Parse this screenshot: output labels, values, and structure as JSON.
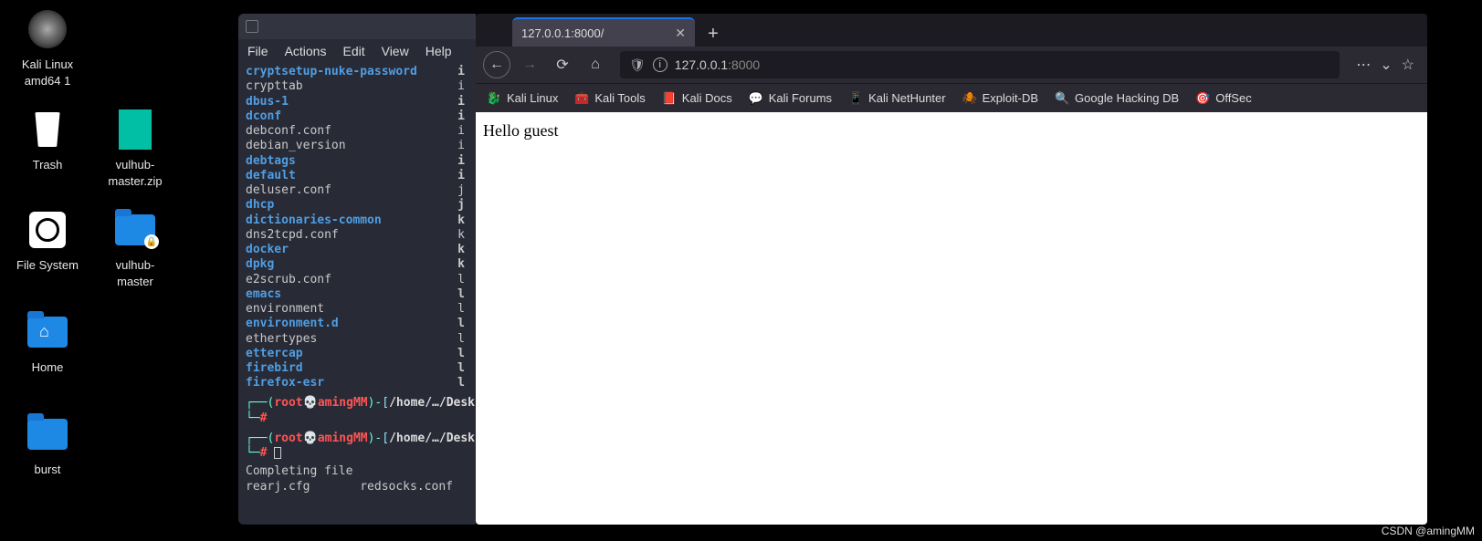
{
  "desktop": {
    "icons": [
      {
        "label": "Kali Linux\namd64 1"
      },
      {
        "label": "Trash"
      },
      {
        "label": "vulhub-\nmaster.zip"
      },
      {
        "label": "File System"
      },
      {
        "label": "vulhub-\nmaster"
      },
      {
        "label": "Home"
      },
      {
        "label": "burst"
      }
    ]
  },
  "terminal": {
    "menu": [
      "File",
      "Actions",
      "Edit",
      "View",
      "Help"
    ],
    "listing": [
      {
        "name": "cryptsetup-nuke-password",
        "type": "dir",
        "col2": "i"
      },
      {
        "name": "crypttab",
        "type": "file",
        "col2": "i"
      },
      {
        "name": "dbus-1",
        "type": "dir",
        "col2": "i"
      },
      {
        "name": "dconf",
        "type": "dir",
        "col2": "i"
      },
      {
        "name": "debconf.conf",
        "type": "file",
        "col2": "i"
      },
      {
        "name": "debian_version",
        "type": "file",
        "col2": "i"
      },
      {
        "name": "debtags",
        "type": "dir",
        "col2": "i"
      },
      {
        "name": "default",
        "type": "dir",
        "col2": "i"
      },
      {
        "name": "deluser.conf",
        "type": "file",
        "col2": "j"
      },
      {
        "name": "dhcp",
        "type": "dir",
        "col2": "j"
      },
      {
        "name": "dictionaries-common",
        "type": "dir",
        "col2": "k"
      },
      {
        "name": "dns2tcpd.conf",
        "type": "file",
        "col2": "k"
      },
      {
        "name": "docker",
        "type": "dir",
        "col2": "k"
      },
      {
        "name": "dpkg",
        "type": "dir",
        "col2": "k"
      },
      {
        "name": "e2scrub.conf",
        "type": "file",
        "col2": "l"
      },
      {
        "name": "emacs",
        "type": "dir",
        "col2": "l"
      },
      {
        "name": "environment",
        "type": "file",
        "col2": "l"
      },
      {
        "name": "environment.d",
        "type": "dir",
        "col2": "l"
      },
      {
        "name": "ethertypes",
        "type": "file",
        "col2": "l"
      },
      {
        "name": "ettercap",
        "type": "dir",
        "col2": "l"
      },
      {
        "name": "firebird",
        "type": "dir",
        "col2": "l"
      },
      {
        "name": "firefox-esr",
        "type": "dir",
        "col2": "l"
      }
    ],
    "prompt": {
      "user": "root",
      "host": "amingMM",
      "path": "/home/…/Desk"
    },
    "completing": "Completing file",
    "bottom": "rearj.cfg       redsocks.conf"
  },
  "browser": {
    "tab_title": "127.0.0.1:8000/",
    "url_main": "127.0.0.1",
    "url_port": ":8000",
    "bookmarks": [
      "Kali Linux",
      "Kali Tools",
      "Kali Docs",
      "Kali Forums",
      "Kali NetHunter",
      "Exploit-DB",
      "Google Hacking DB",
      "OffSec"
    ],
    "content": "Hello guest"
  },
  "watermark": "CSDN @amingMM"
}
